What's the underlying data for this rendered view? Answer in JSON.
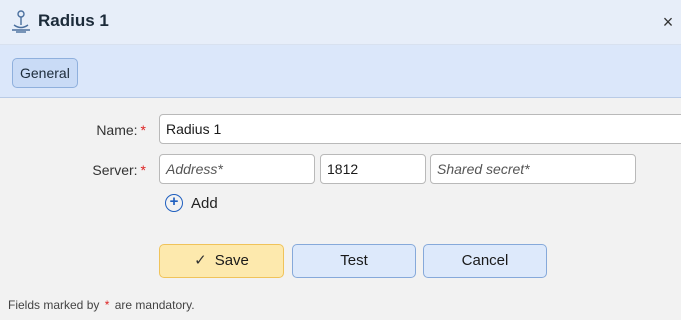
{
  "window": {
    "title": "Radius 1",
    "icon": "radius-server-icon",
    "close_glyph": "×"
  },
  "tabs": [
    {
      "label": "General",
      "active": true
    }
  ],
  "form": {
    "name": {
      "label": "Name:",
      "required_mark": "*",
      "value": "Radius 1"
    },
    "server": {
      "label": "Server:",
      "required_mark": "*",
      "address_placeholder": "Address*",
      "port_value": "1812",
      "secret_placeholder": "Shared secret*"
    },
    "add_label": "Add",
    "add_icon": "plus-circle-icon"
  },
  "buttons": {
    "save": "Save",
    "save_icon": "checkmark-icon",
    "test": "Test",
    "cancel": "Cancel"
  },
  "footer": {
    "prefix": "Fields marked by",
    "mark": "*",
    "suffix": "are mandatory."
  },
  "colors": {
    "required": "#d22222",
    "primary_button": "#fde9ad",
    "secondary_button": "#dde9fb",
    "tab_bar": "#dbe7fa",
    "title_bar": "#e7eef9"
  }
}
